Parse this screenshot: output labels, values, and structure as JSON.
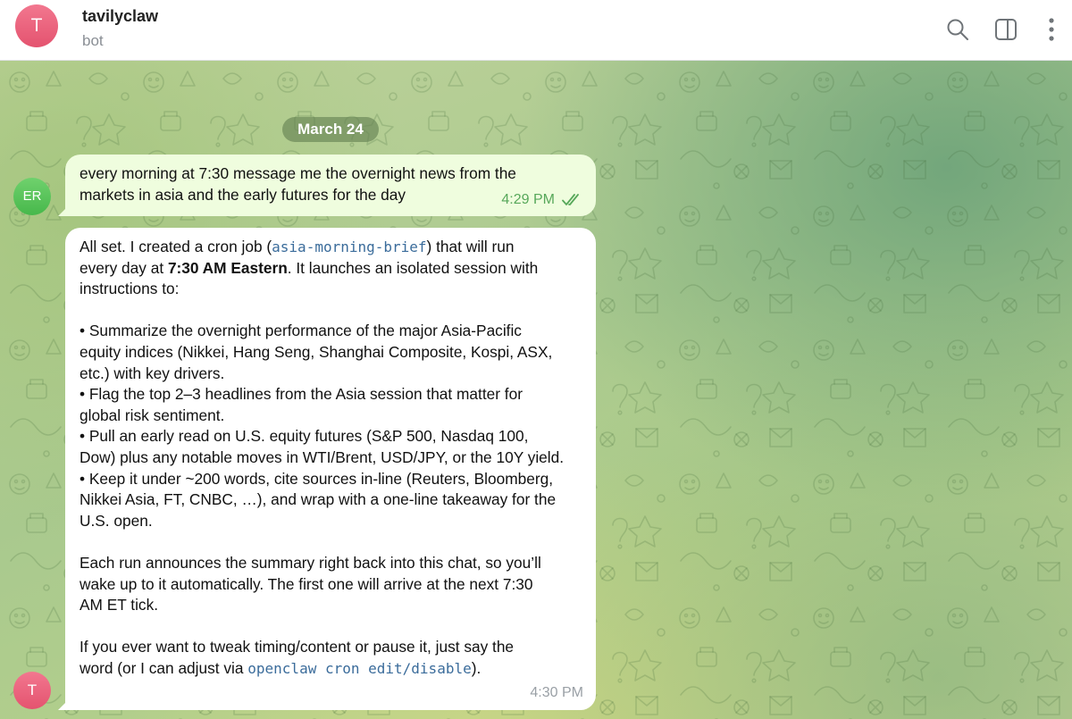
{
  "header": {
    "avatar_letter": "T",
    "chat_name": "tavilyclaw",
    "status": "bot",
    "icons": [
      "search-icon",
      "sidebar-toggle-icon",
      "more-vertical-icon"
    ]
  },
  "chat": {
    "date_separator": "March 24",
    "user_avatar_initials": "ER",
    "bot_avatar_letter": "T",
    "outgoing": {
      "lines": [
        "every morning at 7:30 message me the overnight news from the",
        "markets in asia and the early futures for the day"
      ],
      "time": "4:29 PM",
      "status_icon": "double-check-icon"
    },
    "incoming": {
      "p1_line1_a": "All set. I created a cron job (",
      "p1_line1_code": "asia-morning-brief",
      "p1_line1_b": ") that will run",
      "p1_line2_a": "every day at ",
      "p1_line2_bold": "7:30 AM Eastern",
      "p1_line2_b": ". It launches an isolated session with",
      "p1_line3": "instructions to:",
      "bullet_lines": [
        "• Summarize the overnight performance of the major Asia-Pacific",
        "equity indices (Nikkei, Hang Seng, Shanghai Composite, Kospi, ASX,",
        "etc.) with key drivers.",
        "• Flag the top 2–3 headlines from the Asia session that matter for",
        "global risk sentiment.",
        "• Pull an early read on U.S. equity futures (S&P 500, Nasdaq 100,",
        "Dow) plus any notable moves in WTI/Brent, USD/JPY, or the 10Y yield.",
        "• Keep it under ~200 words, cite sources in-line (Reuters, Bloomberg,",
        "Nikkei Asia, FT, CNBC, …), and wrap with a one-line takeaway for the",
        "U.S. open."
      ],
      "p3_lines": [
        "Each run announces the summary right back into this chat, so you’ll",
        "wake up to it automatically. The first one will arrive at the next 7:30",
        "AM ET tick."
      ],
      "p4_line1": "If you ever want to tweak timing/content or pause it, just say the",
      "p4_line2_a": "word (or I can adjust via ",
      "p4_line2_code": "openclaw cron edit/disable",
      "p4_line2_b": ").",
      "time": "4:30 PM"
    }
  },
  "colors": {
    "outgoing_bubble": "#effdde",
    "incoming_bubble": "#ffffff",
    "outgoing_time": "#57a85a",
    "code_text": "#3b6c9b",
    "bot_avatar": "#e4536f",
    "user_avatar": "#47b84b"
  }
}
